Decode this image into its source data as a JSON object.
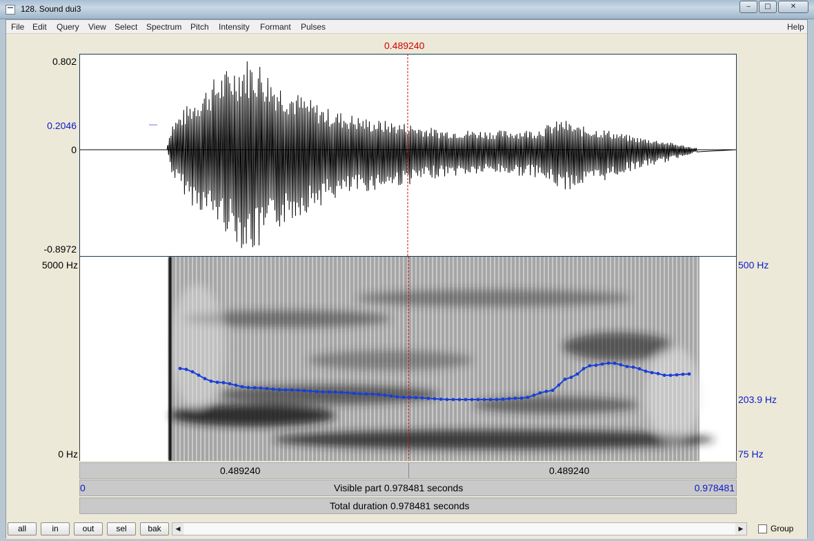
{
  "window": {
    "title": "128. Sound dui3",
    "controls": [
      "minimize",
      "maximize",
      "close"
    ]
  },
  "menu": [
    "File",
    "Edit",
    "Query",
    "View",
    "Select",
    "Spectrum",
    "Pitch",
    "Intensity",
    "Formant",
    "Pulses"
  ],
  "help": "Help",
  "cursor_time": "0.489240",
  "waveform": {
    "y_max": "0.802",
    "y_cursor": "0.2046",
    "y_zero": "0",
    "y_min": "-0.8972"
  },
  "spectrogram": {
    "freq_top": "5000 Hz",
    "freq_bottom": "0 Hz",
    "pitch_top": "500 Hz",
    "pitch_cursor": "203.9 Hz",
    "pitch_bottom": "75 Hz"
  },
  "time_bars": {
    "left_segment": "0.489240",
    "right_segment": "0.489240",
    "visible_start": "0",
    "visible_label": "Visible part 0.978481 seconds",
    "visible_end": "0.978481",
    "total_label": "Total duration 0.978481 seconds"
  },
  "buttons": [
    "all",
    "in",
    "out",
    "sel",
    "bak"
  ],
  "group_label": "Group",
  "colors": {
    "cursor": "#d40000",
    "pitch_curve": "#1a3fd6",
    "axis_blue": "#0a1ac8"
  }
}
